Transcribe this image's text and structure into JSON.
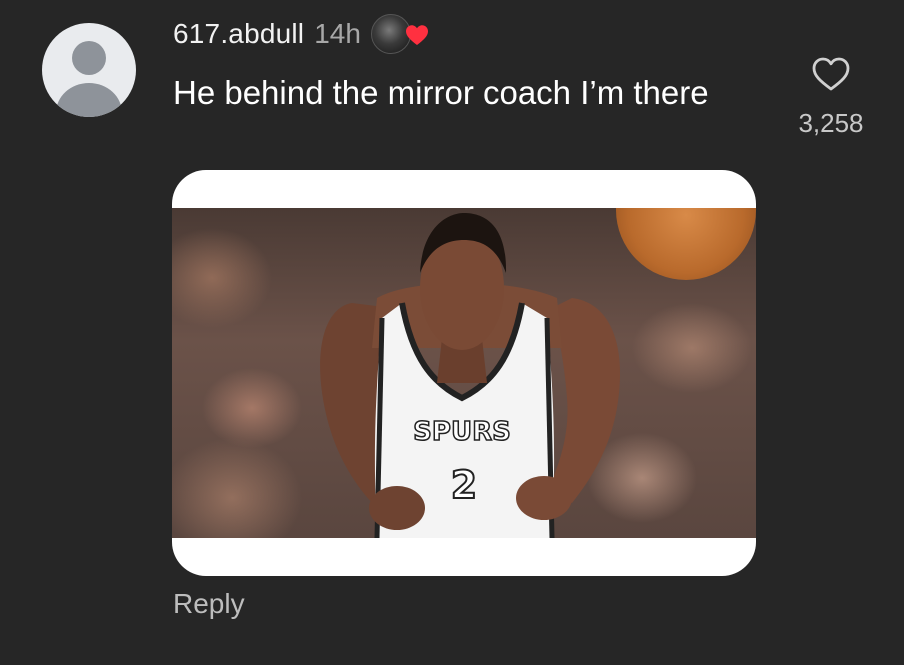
{
  "comment": {
    "username": "617.abdull",
    "timestamp": "14h",
    "text": "He behind the mirror coach I’m there",
    "like_count": "3,258",
    "reply_label": "Reply",
    "liked_by_creator": true,
    "creator_heart_color": "#ff3040"
  },
  "icons": {
    "avatar": "default-avatar-icon",
    "like": "heart-outline-icon",
    "creator_like": "creator-heart-badge-icon"
  },
  "media": {
    "type": "image",
    "jersey_text": "SPURS",
    "jersey_number": "2"
  },
  "colors": {
    "background": "#262626",
    "text_primary": "#ffffff",
    "text_secondary": "#a8a8a8",
    "heart_red": "#ff3040"
  }
}
